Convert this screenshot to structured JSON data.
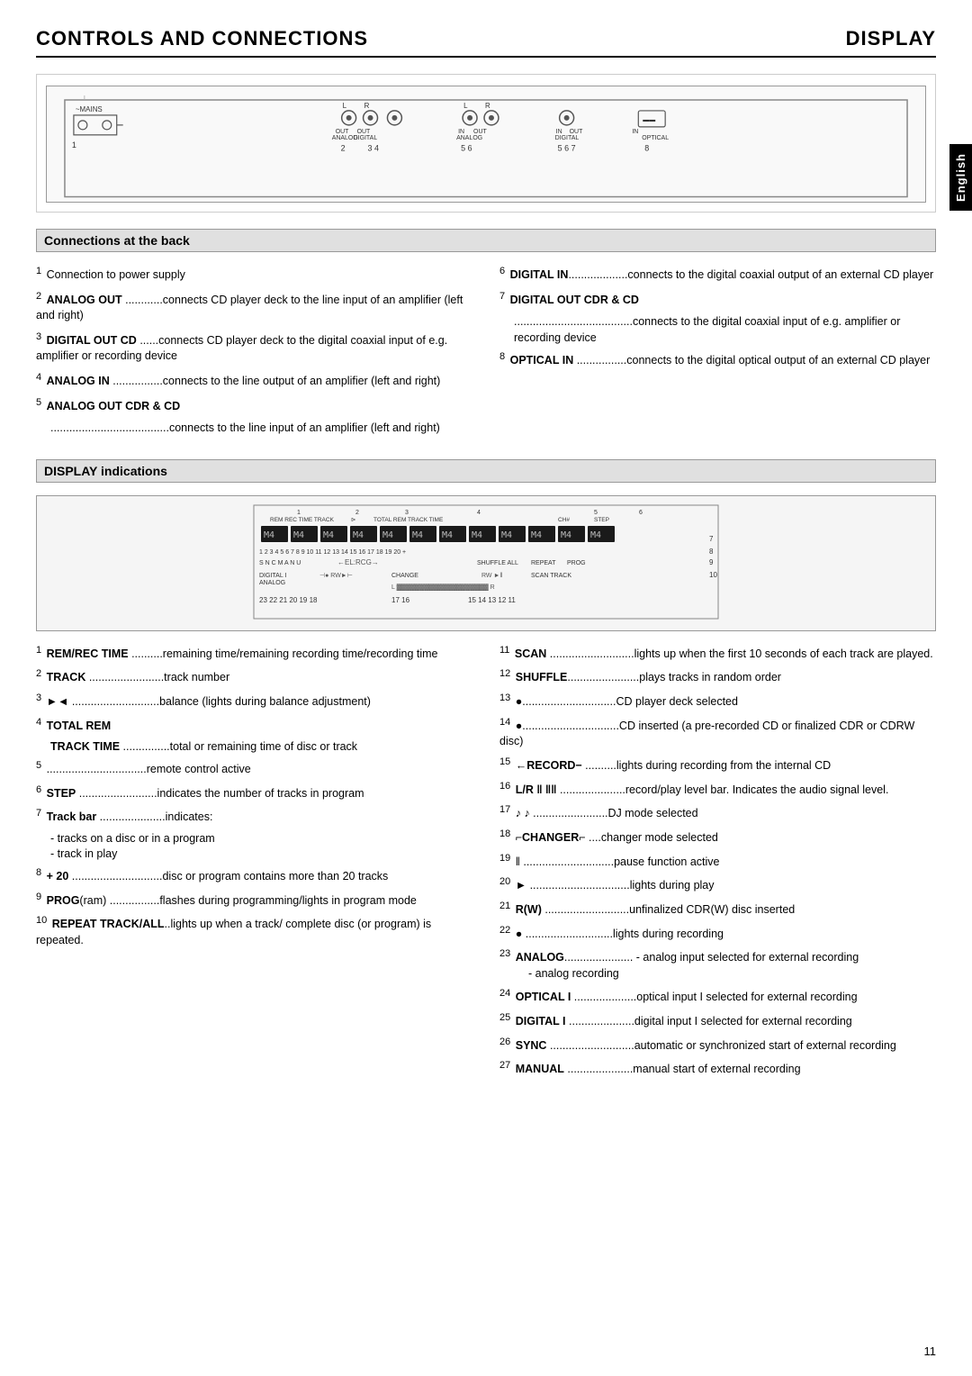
{
  "header": {
    "left_title": "CONTROLS AND CONNECTIONS",
    "right_title": "DISPLAY"
  },
  "english_tab": "English",
  "connections": {
    "heading": "Connections at the back",
    "items": [
      {
        "num": "1",
        "label": "",
        "text": "Connection to power supply"
      },
      {
        "num": "2",
        "label": "ANALOG OUT",
        "text": "connects CD player deck to the line input of an amplifier (left and right)"
      },
      {
        "num": "3",
        "label": "DIGITAL OUT CD",
        "text": "......connects CD player deck to the digital coaxial input of e.g. amplifier or recording device"
      },
      {
        "num": "4",
        "label": "ANALOG IN",
        "text": "................connects to the line output of an amplifier (left and right)"
      },
      {
        "num": "5",
        "label": "ANALOG OUT CDR & CD",
        "text": "",
        "sub": "......................................connects to the line input of an amplifier (left and right)"
      },
      {
        "num": "6",
        "label": "DIGITAL IN",
        "text": "...................connects to the digital coaxial output of an external CD player"
      },
      {
        "num": "7",
        "label": "DIGITAL OUT CDR & CD",
        "text": "",
        "sub": "......................................connects to the digital coaxial input of e.g. amplifier or recording device"
      },
      {
        "num": "8",
        "label": "OPTICAL IN",
        "text": "................connects to the digital optical output of an external CD player"
      }
    ]
  },
  "display": {
    "heading": "DISPLAY indications",
    "items_left": [
      {
        "num": "1",
        "label": "REM/REC TIME",
        "text": "..........remaining time/remaining recording time/recording time"
      },
      {
        "num": "2",
        "label": "TRACK",
        "text": "........................track number"
      },
      {
        "num": "3",
        "label": "►◄",
        "text": "............................balance (lights during balance adjustment)"
      },
      {
        "num": "4",
        "label": "TOTAL REM",
        "text": "",
        "sub": "TRACK TIME ...............total or remaining time of disc or track"
      },
      {
        "num": "5",
        "label": "",
        "text": "................................remote control active"
      },
      {
        "num": "6",
        "label": "STEP",
        "text": ".........................indicates the number of tracks in program"
      },
      {
        "num": "7",
        "label": "Track bar",
        "text": ".....................indicates:",
        "sub2": "- tracks on a disc or in a program\n- track in play"
      },
      {
        "num": "8",
        "label": "+ 20",
        "text": ".............................disc or program contains more than 20 tracks"
      },
      {
        "num": "9",
        "label": "PROG(ram)",
        "text": "................flashes during programming/lights in program mode"
      },
      {
        "num": "10",
        "label": "REPEAT TRACK/ALL",
        "text": "..lights up when a track/ complete disc (or program) is repeated."
      }
    ],
    "items_right": [
      {
        "num": "11",
        "label": "SCAN",
        "text": "...........................lights up when the first 10 seconds of each track are played."
      },
      {
        "num": "12",
        "label": "SHUFFLE",
        "text": ".......................plays tracks in random order"
      },
      {
        "num": "13",
        "label": "●",
        "text": "..............................CD player deck selected"
      },
      {
        "num": "14",
        "label": "●",
        "text": "...............................CD inserted (a pre-recorded CD or finalized CDR or CDRW disc)"
      },
      {
        "num": "15",
        "label": "←RECORD−",
        "text": "..........lights during recording from the internal CD"
      },
      {
        "num": "16",
        "label": "L/R ‖ ‖‖",
        "text": ".....................record/play level bar. Indicates the audio signal level."
      },
      {
        "num": "17",
        "label": "♪ ♪",
        "text": "........................DJ mode selected"
      },
      {
        "num": "18",
        "label": "⌐CHANGER⌐",
        "text": "....changer mode selected"
      },
      {
        "num": "19",
        "label": "‖",
        "text": ".............................pause function active"
      },
      {
        "num": "20",
        "label": "►",
        "text": "................................lights during play"
      },
      {
        "num": "21",
        "label": "R(W)",
        "text": "...........................unfinalized CDR(W) disc inserted"
      },
      {
        "num": "22",
        "label": "●",
        "text": "............................lights during recording"
      },
      {
        "num": "23",
        "label": "ANALOG",
        "text": "...................... - analog input selected for external recording\n - analog recording"
      },
      {
        "num": "24",
        "label": "OPTICAL I",
        "text": "....................optical input I selected for external recording"
      },
      {
        "num": "25",
        "label": "DIGITAL I",
        "text": ".....................digital input I selected for external recording"
      },
      {
        "num": "26",
        "label": "SYNC",
        "text": "...........................automatic or synchronized start of external recording"
      },
      {
        "num": "27",
        "label": "MANUAL",
        "text": ".....................manual start of external recording"
      }
    ]
  },
  "page_number": "11"
}
